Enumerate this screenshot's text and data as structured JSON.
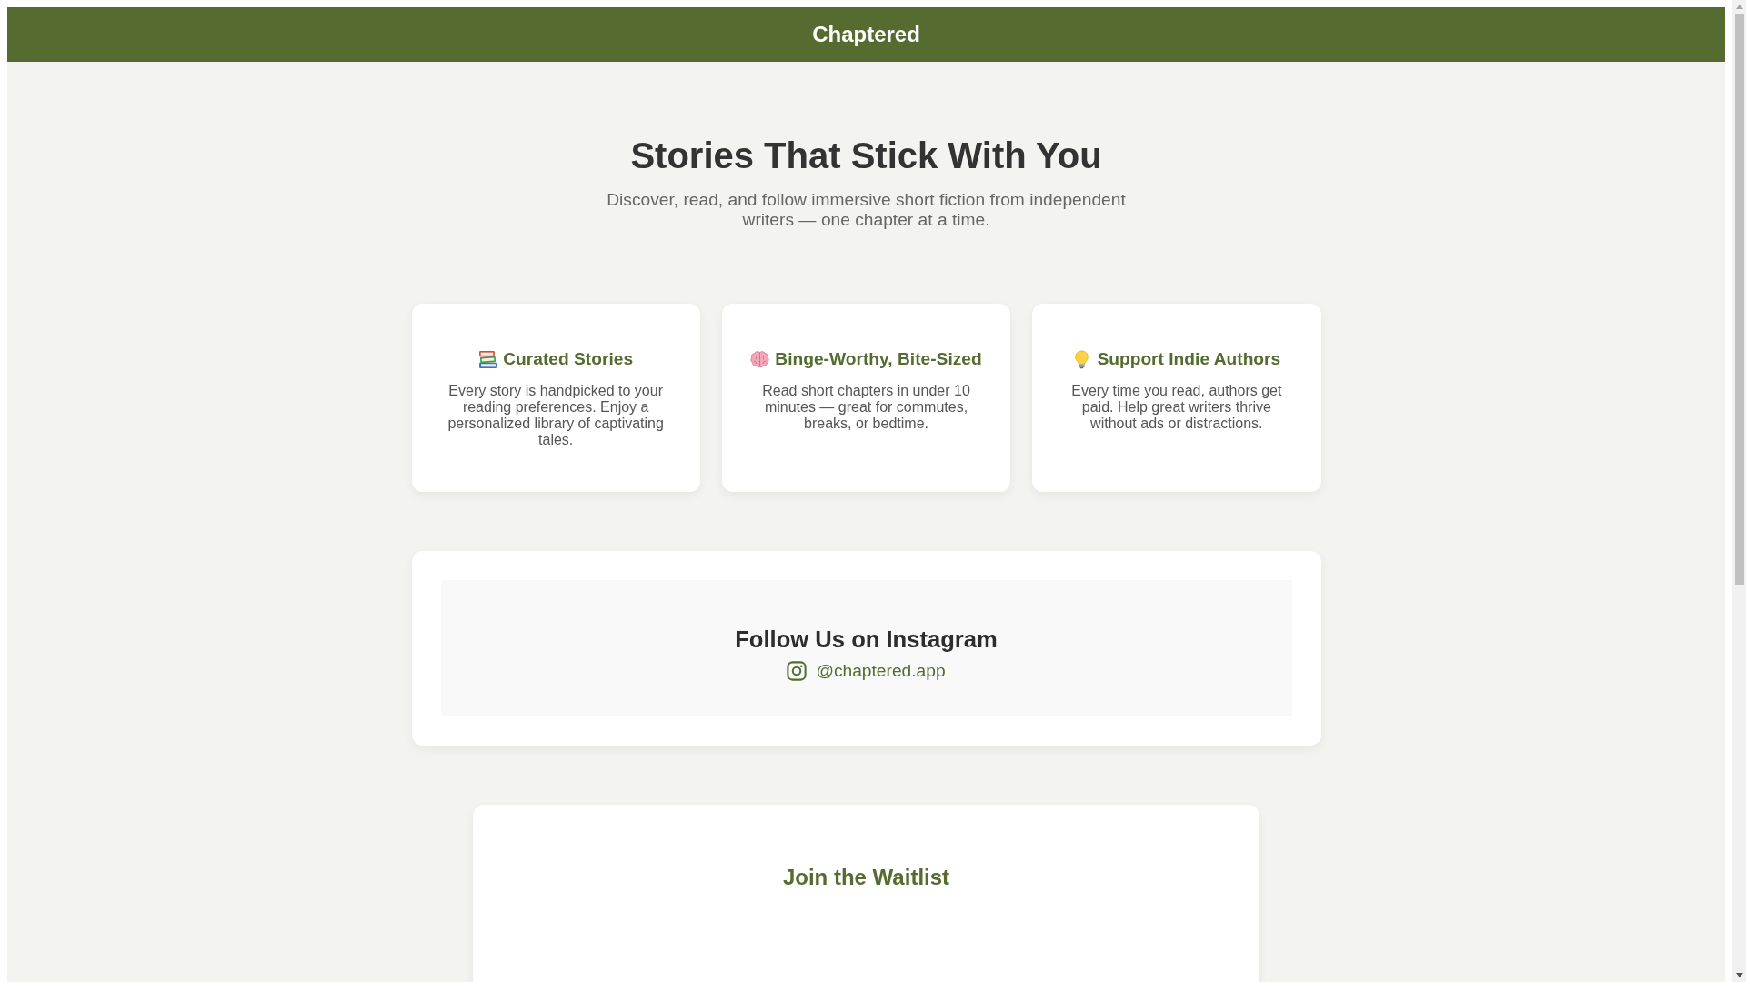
{
  "header": {
    "title": "Chaptered"
  },
  "hero": {
    "title": "Stories That Stick With You",
    "subtitle": "Discover, read, and follow immersive short fiction from independent writers — one chapter at a time."
  },
  "features": [
    {
      "title": "Curated Stories",
      "text": "Every story is handpicked to your reading preferences. Enjoy a personalized library of captivating tales."
    },
    {
      "title": "Binge-Worthy, Bite-Sized",
      "text": "Read short chapters in under 10 minutes — great for commutes, breaks, or bedtime."
    },
    {
      "title": "Support Indie Authors",
      "text": "Every time you read, authors get paid. Help great writers thrive without ads or distractions."
    }
  ],
  "instagram": {
    "title": "Follow Us on Instagram",
    "handle": "@chaptered.app"
  },
  "waitlist": {
    "title": "Join the Waitlist"
  }
}
